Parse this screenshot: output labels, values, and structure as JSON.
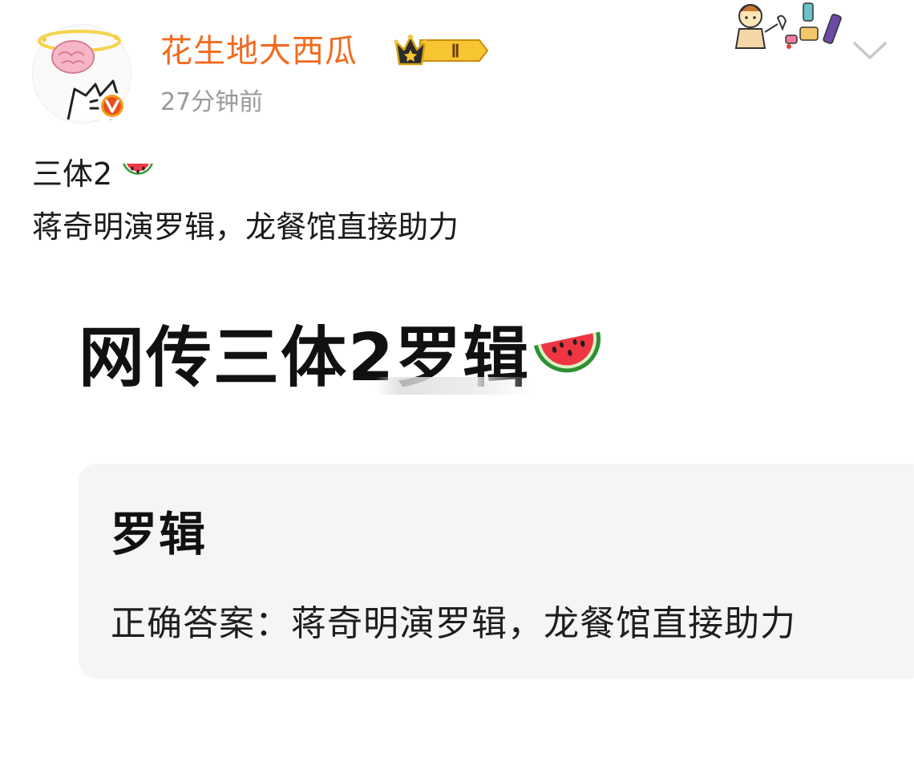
{
  "post": {
    "author": {
      "name": "花生地大西瓜",
      "vip_level": "Ⅱ",
      "verified": true
    },
    "timestamp": "27分钟前",
    "text_line1": "三体2",
    "text_line2": "蒋奇明演罗辑，龙餐馆直接助力"
  },
  "image": {
    "headline": "网传三体2罗辑",
    "card": {
      "title": "罗辑",
      "text": "正确答案：蒋奇明演罗辑，龙餐馆直接助力"
    }
  },
  "icons": {
    "avatar": "cartoon-cat-with-brain-halo",
    "verified": "orange-v-verified-badge",
    "vip": "crown-vip-level-badge",
    "melon": "watermelon-emoji",
    "sticker": "cartoon-girl-food-sticker",
    "menu": "chevron-down-icon"
  },
  "colors": {
    "username": "#f26a1f",
    "timestamp": "#9a9a9a",
    "card_bg": "#f5f5f5",
    "verified": "#e8501e",
    "vip_gold": "#f4b400"
  }
}
